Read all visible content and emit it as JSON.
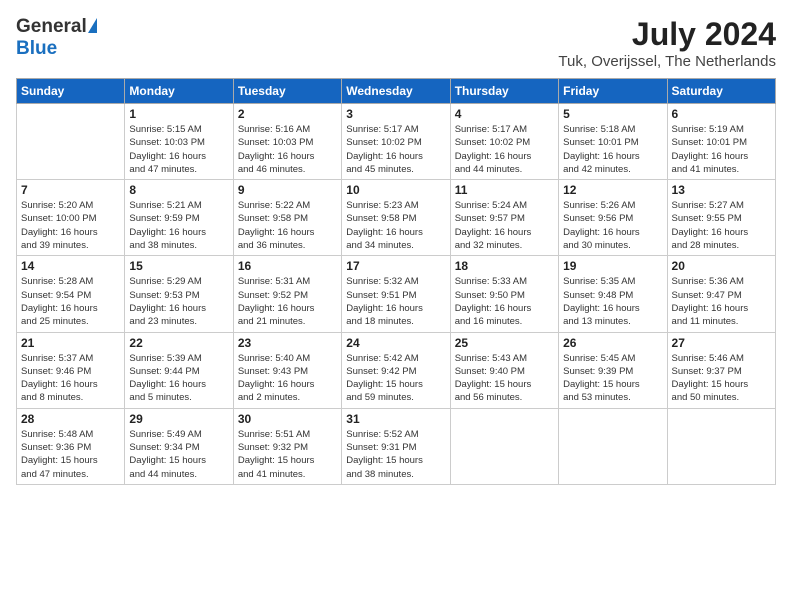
{
  "header": {
    "logo_general": "General",
    "logo_blue": "Blue",
    "month_year": "July 2024",
    "location": "Tuk, Overijssel, The Netherlands"
  },
  "weekdays": [
    "Sunday",
    "Monday",
    "Tuesday",
    "Wednesday",
    "Thursday",
    "Friday",
    "Saturday"
  ],
  "weeks": [
    [
      {
        "day": "",
        "info": ""
      },
      {
        "day": "1",
        "info": "Sunrise: 5:15 AM\nSunset: 10:03 PM\nDaylight: 16 hours\nand 47 minutes."
      },
      {
        "day": "2",
        "info": "Sunrise: 5:16 AM\nSunset: 10:03 PM\nDaylight: 16 hours\nand 46 minutes."
      },
      {
        "day": "3",
        "info": "Sunrise: 5:17 AM\nSunset: 10:02 PM\nDaylight: 16 hours\nand 45 minutes."
      },
      {
        "day": "4",
        "info": "Sunrise: 5:17 AM\nSunset: 10:02 PM\nDaylight: 16 hours\nand 44 minutes."
      },
      {
        "day": "5",
        "info": "Sunrise: 5:18 AM\nSunset: 10:01 PM\nDaylight: 16 hours\nand 42 minutes."
      },
      {
        "day": "6",
        "info": "Sunrise: 5:19 AM\nSunset: 10:01 PM\nDaylight: 16 hours\nand 41 minutes."
      }
    ],
    [
      {
        "day": "7",
        "info": "Sunrise: 5:20 AM\nSunset: 10:00 PM\nDaylight: 16 hours\nand 39 minutes."
      },
      {
        "day": "8",
        "info": "Sunrise: 5:21 AM\nSunset: 9:59 PM\nDaylight: 16 hours\nand 38 minutes."
      },
      {
        "day": "9",
        "info": "Sunrise: 5:22 AM\nSunset: 9:58 PM\nDaylight: 16 hours\nand 36 minutes."
      },
      {
        "day": "10",
        "info": "Sunrise: 5:23 AM\nSunset: 9:58 PM\nDaylight: 16 hours\nand 34 minutes."
      },
      {
        "day": "11",
        "info": "Sunrise: 5:24 AM\nSunset: 9:57 PM\nDaylight: 16 hours\nand 32 minutes."
      },
      {
        "day": "12",
        "info": "Sunrise: 5:26 AM\nSunset: 9:56 PM\nDaylight: 16 hours\nand 30 minutes."
      },
      {
        "day": "13",
        "info": "Sunrise: 5:27 AM\nSunset: 9:55 PM\nDaylight: 16 hours\nand 28 minutes."
      }
    ],
    [
      {
        "day": "14",
        "info": "Sunrise: 5:28 AM\nSunset: 9:54 PM\nDaylight: 16 hours\nand 25 minutes."
      },
      {
        "day": "15",
        "info": "Sunrise: 5:29 AM\nSunset: 9:53 PM\nDaylight: 16 hours\nand 23 minutes."
      },
      {
        "day": "16",
        "info": "Sunrise: 5:31 AM\nSunset: 9:52 PM\nDaylight: 16 hours\nand 21 minutes."
      },
      {
        "day": "17",
        "info": "Sunrise: 5:32 AM\nSunset: 9:51 PM\nDaylight: 16 hours\nand 18 minutes."
      },
      {
        "day": "18",
        "info": "Sunrise: 5:33 AM\nSunset: 9:50 PM\nDaylight: 16 hours\nand 16 minutes."
      },
      {
        "day": "19",
        "info": "Sunrise: 5:35 AM\nSunset: 9:48 PM\nDaylight: 16 hours\nand 13 minutes."
      },
      {
        "day": "20",
        "info": "Sunrise: 5:36 AM\nSunset: 9:47 PM\nDaylight: 16 hours\nand 11 minutes."
      }
    ],
    [
      {
        "day": "21",
        "info": "Sunrise: 5:37 AM\nSunset: 9:46 PM\nDaylight: 16 hours\nand 8 minutes."
      },
      {
        "day": "22",
        "info": "Sunrise: 5:39 AM\nSunset: 9:44 PM\nDaylight: 16 hours\nand 5 minutes."
      },
      {
        "day": "23",
        "info": "Sunrise: 5:40 AM\nSunset: 9:43 PM\nDaylight: 16 hours\nand 2 minutes."
      },
      {
        "day": "24",
        "info": "Sunrise: 5:42 AM\nSunset: 9:42 PM\nDaylight: 15 hours\nand 59 minutes."
      },
      {
        "day": "25",
        "info": "Sunrise: 5:43 AM\nSunset: 9:40 PM\nDaylight: 15 hours\nand 56 minutes."
      },
      {
        "day": "26",
        "info": "Sunrise: 5:45 AM\nSunset: 9:39 PM\nDaylight: 15 hours\nand 53 minutes."
      },
      {
        "day": "27",
        "info": "Sunrise: 5:46 AM\nSunset: 9:37 PM\nDaylight: 15 hours\nand 50 minutes."
      }
    ],
    [
      {
        "day": "28",
        "info": "Sunrise: 5:48 AM\nSunset: 9:36 PM\nDaylight: 15 hours\nand 47 minutes."
      },
      {
        "day": "29",
        "info": "Sunrise: 5:49 AM\nSunset: 9:34 PM\nDaylight: 15 hours\nand 44 minutes."
      },
      {
        "day": "30",
        "info": "Sunrise: 5:51 AM\nSunset: 9:32 PM\nDaylight: 15 hours\nand 41 minutes."
      },
      {
        "day": "31",
        "info": "Sunrise: 5:52 AM\nSunset: 9:31 PM\nDaylight: 15 hours\nand 38 minutes."
      },
      {
        "day": "",
        "info": ""
      },
      {
        "day": "",
        "info": ""
      },
      {
        "day": "",
        "info": ""
      }
    ]
  ]
}
